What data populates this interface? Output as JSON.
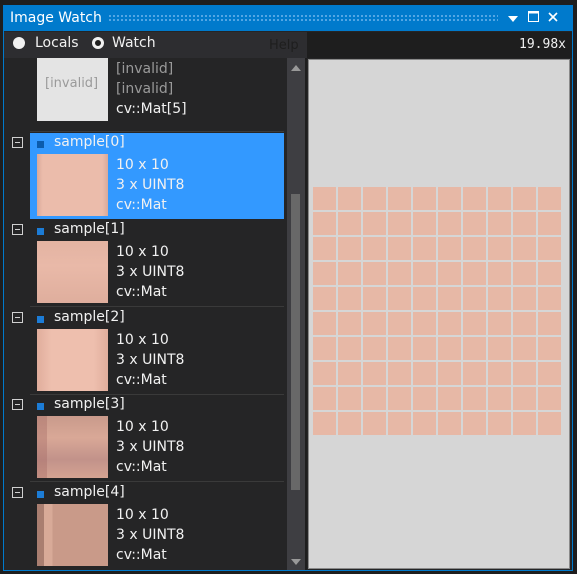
{
  "window": {
    "title": "Image Watch",
    "dropdown_icon": "dropdown-arrow-icon",
    "maximize_icon": "maximize-icon",
    "close_icon": "close-icon"
  },
  "toolbar": {
    "locals_label": "Locals",
    "watch_label": "Watch",
    "selected_mode": "Watch",
    "help_label": "Help",
    "zoom": "19.98x"
  },
  "list": {
    "partial_item": {
      "thumb_text": "[invalid]",
      "lines": [
        "[invalid]",
        "[invalid]",
        "cv::Mat[5]"
      ]
    },
    "items": [
      {
        "name": "sample[0]",
        "size": "10 x 10",
        "type": "3 x UINT8",
        "class": "cv::Mat",
        "selected": true
      },
      {
        "name": "sample[1]",
        "size": "10 x 10",
        "type": "3 x UINT8",
        "class": "cv::Mat",
        "selected": false
      },
      {
        "name": "sample[2]",
        "size": "10 x 10",
        "type": "3 x UINT8",
        "class": "cv::Mat",
        "selected": false
      },
      {
        "name": "sample[3]",
        "size": "10 x 10",
        "type": "3 x UINT8",
        "class": "cv::Mat",
        "selected": false
      },
      {
        "name": "sample[4]",
        "size": "10 x 10",
        "type": "3 x UINT8",
        "class": "cv::Mat",
        "selected": false
      }
    ]
  },
  "viewer": {
    "grid_rows": 10,
    "grid_cols": 10,
    "pixel_color": "#e7b8a6"
  },
  "colors": {
    "accent": "#007acc",
    "selection": "#3399ff",
    "background": "#252526"
  }
}
